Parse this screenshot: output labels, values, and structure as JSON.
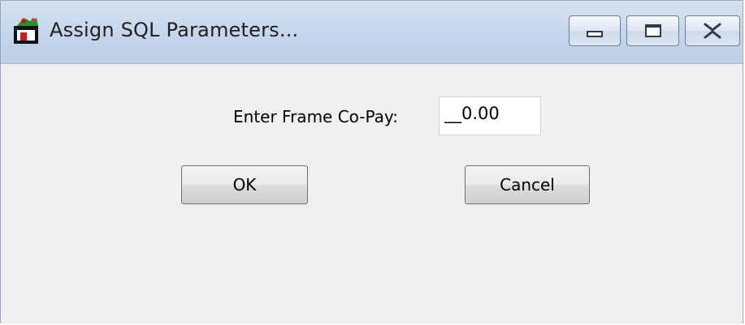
{
  "window": {
    "title": "Assign SQL Parameters...",
    "controls": {
      "minimize_icon": "minimize-icon",
      "maximize_icon": "maximize-icon",
      "close_icon": "close-icon"
    }
  },
  "form": {
    "copay_label": "Enter Frame Co-Pay:",
    "copay_value": "__0.00"
  },
  "buttons": {
    "ok_label": "OK",
    "cancel_label": "Cancel"
  },
  "colors": {
    "titlebar": "#c4d5ec",
    "background": "#f0f0f0",
    "close_glyph": "#303a48"
  }
}
